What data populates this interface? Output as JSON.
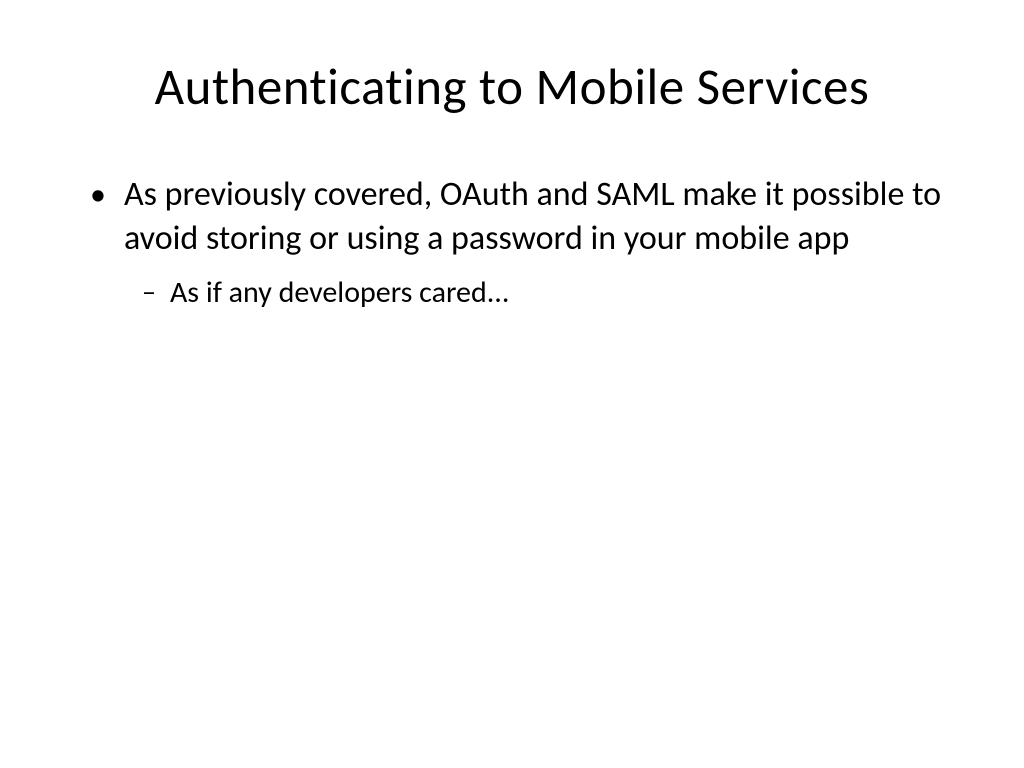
{
  "slide": {
    "title": "Authenticating to Mobile Services",
    "bullets": [
      {
        "text": "As previously covered, OAuth and SAML make it possible to avoid storing or using a password in your mobile app",
        "sub": [
          {
            "text": "As if any developers cared..."
          }
        ]
      }
    ]
  }
}
